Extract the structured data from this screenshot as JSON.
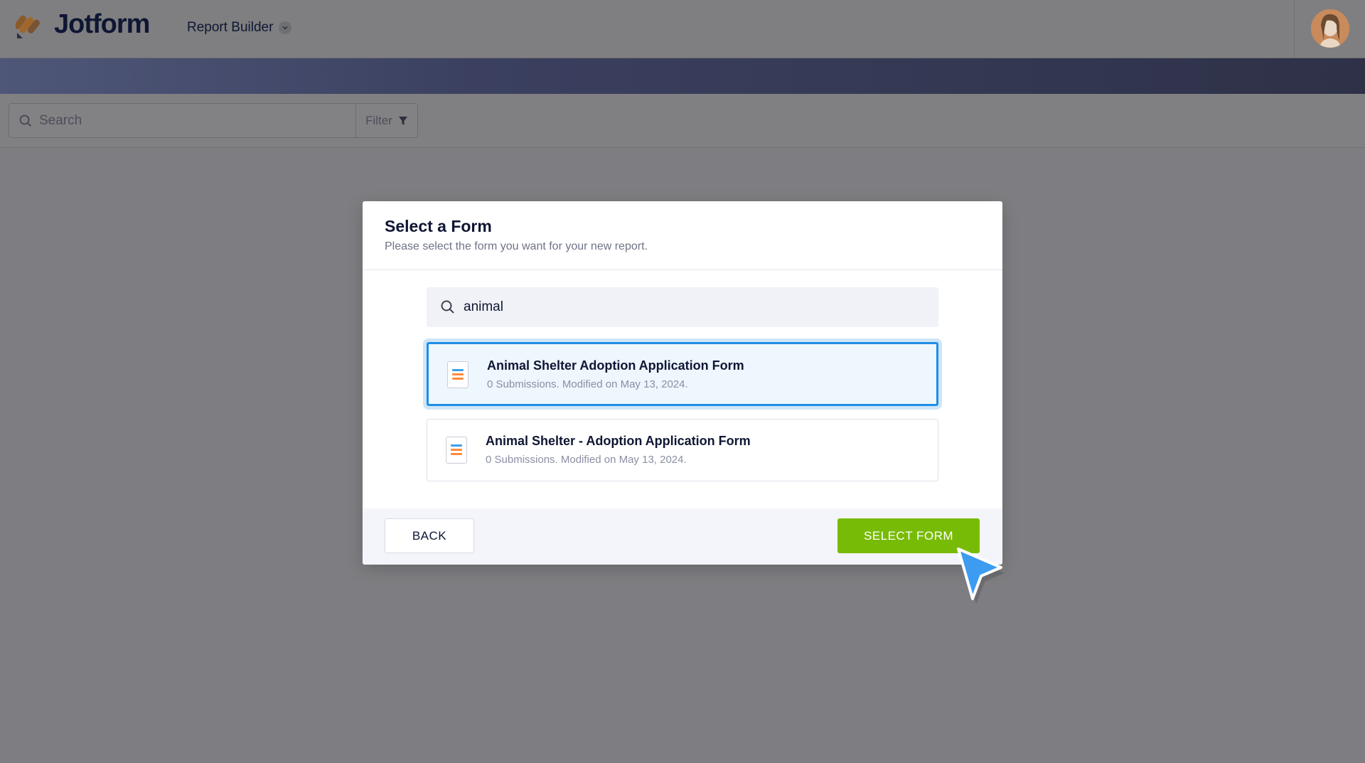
{
  "header": {
    "brand": "Jotform",
    "app_switcher_label": "Report Builder"
  },
  "toolbar": {
    "search_placeholder": "Search",
    "filter_label": "Filter"
  },
  "modal": {
    "title": "Select a Form",
    "subtitle": "Please select the form you want for your new report.",
    "search_value": "animal",
    "forms": [
      {
        "title": "Animal Shelter Adoption Application Form",
        "meta": "0 Submissions. Modified on May 13, 2024.",
        "selected": true
      },
      {
        "title": "Animal Shelter - Adoption Application Form",
        "meta": "0 Submissions. Modified on May 13, 2024.",
        "selected": false
      }
    ],
    "back_label": "BACK",
    "select_label": "SELECT FORM"
  },
  "colors": {
    "brand_dark": "#0f1633",
    "select_green": "#78bb07",
    "selection_blue": "#1e8ee6",
    "icon_orange": "#ff8a3d",
    "icon_blue": "#3ba0ee"
  },
  "icons": [
    "jotform-logo-icon",
    "chevron-down-icon",
    "avatar",
    "search-icon",
    "filter-funnel-icon",
    "form-doc-icon",
    "cursor-pointer-icon"
  ]
}
